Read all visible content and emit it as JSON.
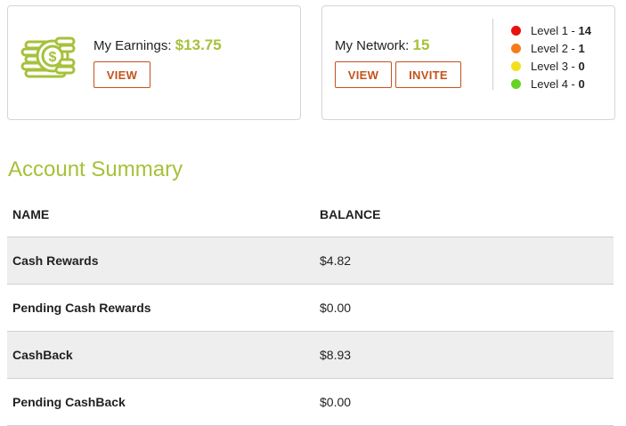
{
  "earnings": {
    "label": "My Earnings:",
    "amount": "$13.75",
    "view_label": "VIEW",
    "icon": "coins-icon"
  },
  "network": {
    "label": "My Network:",
    "count": "15",
    "view_label": "VIEW",
    "invite_label": "INVITE",
    "levels": [
      {
        "label": "Level 1 -",
        "count": "14",
        "color": "#e8120c"
      },
      {
        "label": "Level 2 -",
        "count": "1",
        "color": "#f57c1a"
      },
      {
        "label": "Level 3 -",
        "count": "0",
        "color": "#f2e01e"
      },
      {
        "label": "Level 4 -",
        "count": "0",
        "color": "#66d321"
      }
    ]
  },
  "summary": {
    "title": "Account Summary",
    "headers": {
      "name": "NAME",
      "balance": "BALANCE"
    },
    "rows": [
      {
        "name": "Cash Rewards",
        "balance": "$4.82"
      },
      {
        "name": "Pending Cash Rewards",
        "balance": "$0.00"
      },
      {
        "name": "CashBack",
        "balance": "$8.93"
      },
      {
        "name": "Pending CashBack",
        "balance": "$0.00"
      }
    ]
  },
  "colors": {
    "accent_green": "#a6c13a",
    "button_orange": "#c2531d"
  }
}
